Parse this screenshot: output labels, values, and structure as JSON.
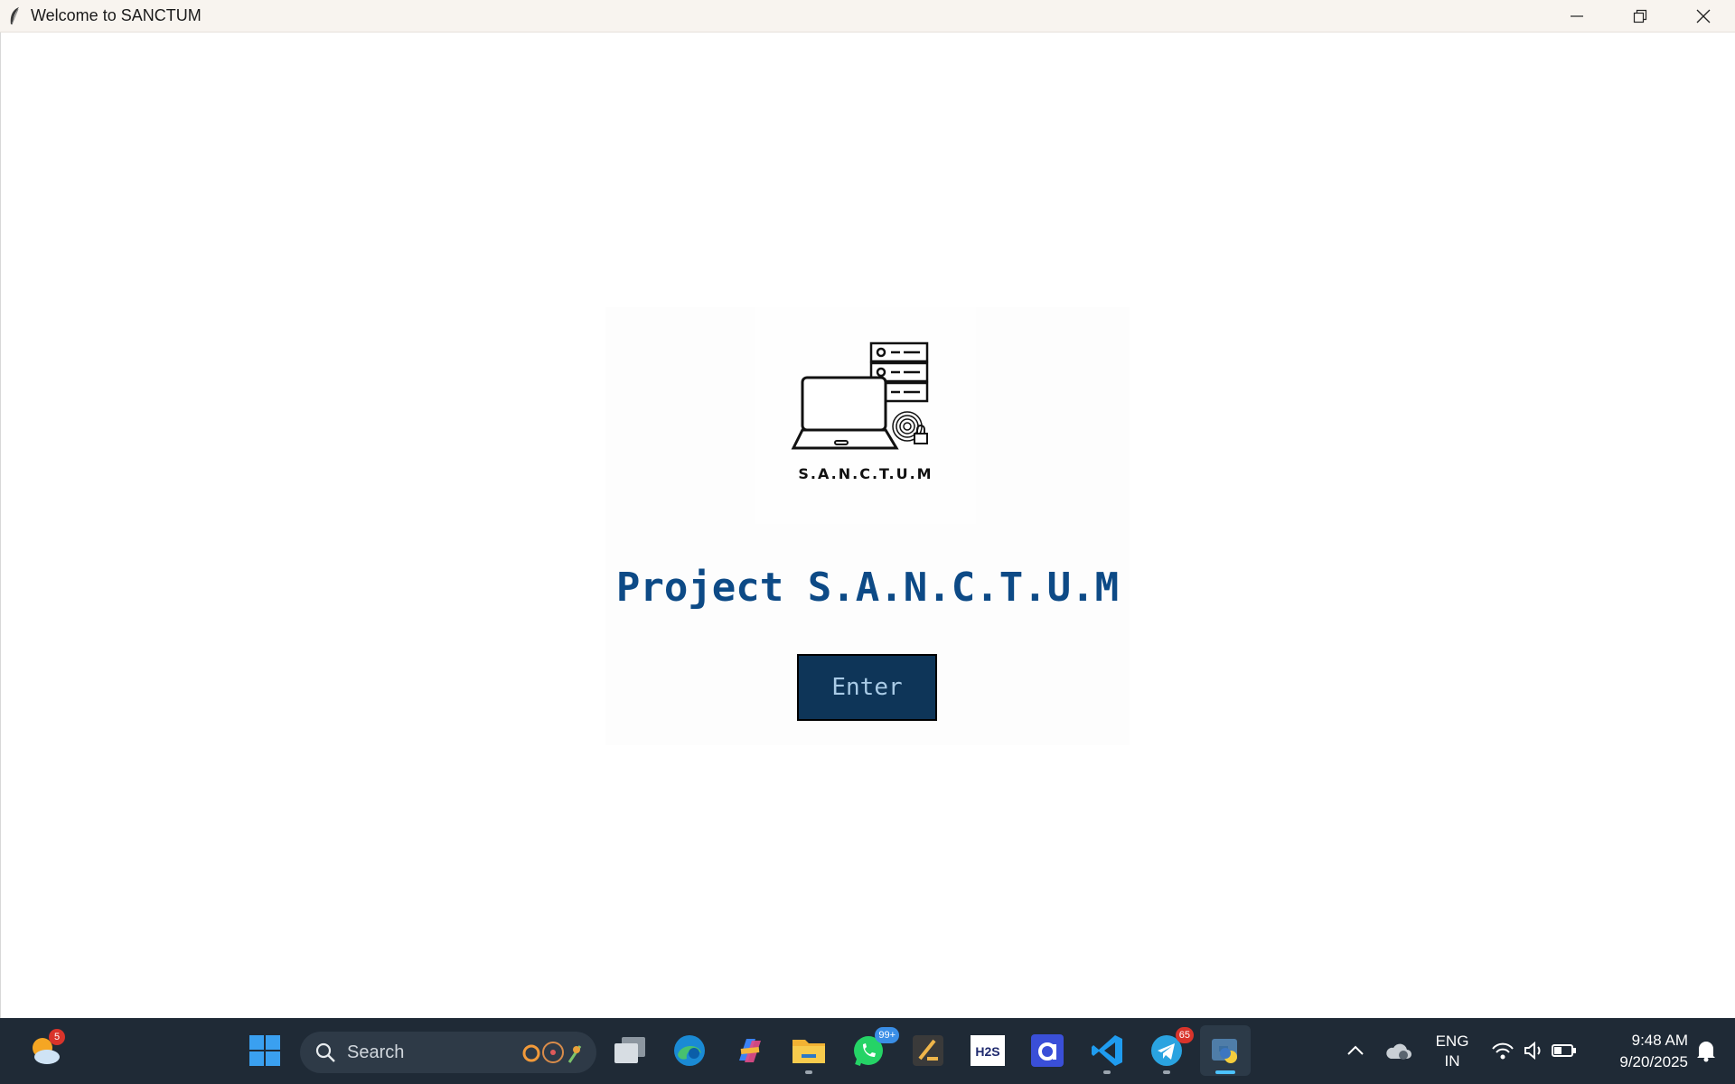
{
  "window": {
    "title": "Welcome to SANCTUM"
  },
  "main": {
    "logo_caption": "S.A.N.C.T.U.M",
    "project_title": "Project S.A.N.C.T.U.M",
    "enter_label": "Enter"
  },
  "colors": {
    "title_blue": "#0d4a86",
    "button_bg": "#0e3558",
    "button_text": "#a9cbe6",
    "taskbar_bg": "#1f2a36"
  },
  "taskbar": {
    "weather_badge": "5",
    "search_placeholder": "Search",
    "whatsapp_badge": "99+",
    "telegram_badge": "65",
    "icons": [
      "weather-icon",
      "windows-start-icon",
      "search-icon",
      "task-view-icon",
      "edge-icon",
      "copilot-icon",
      "file-explorer-icon",
      "whatsapp-icon",
      "app-icon",
      "h2s-icon",
      "app-a-icon",
      "vscode-icon",
      "telegram-icon",
      "python-icon"
    ]
  },
  "tray": {
    "lang_line1": "ENG",
    "lang_line2": "IN",
    "time": "9:48 AM",
    "date": "9/20/2025"
  }
}
